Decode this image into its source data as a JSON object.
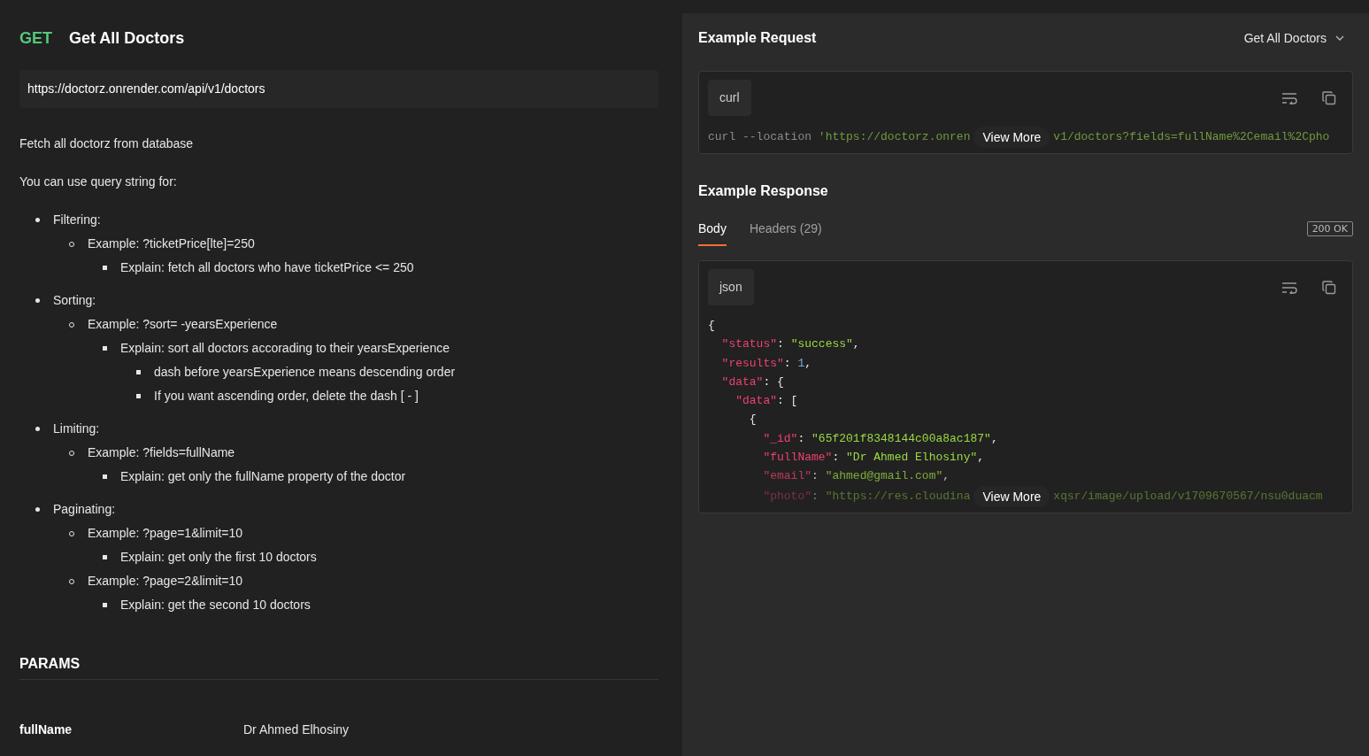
{
  "request": {
    "method": "GET",
    "title": "Get All Doctors",
    "url": "https://doctorz.onrender.com/api/v1/doctors"
  },
  "description": [
    "Fetch all doctorz from database",
    "You can use query string for:"
  ],
  "query_help": [
    {
      "text": "Filtering:",
      "children": [
        {
          "text": "Example: ?ticketPrice[lte]=250",
          "children": [
            {
              "text": "Explain: fetch all doctors who have ticketPrice <= 250"
            }
          ]
        }
      ]
    },
    {
      "text": "Sorting:",
      "children": [
        {
          "text": "Example: ?sort= -yearsExperience",
          "children": [
            {
              "text": "Explain: sort all doctors accorading to their yearsExperience",
              "children": [
                {
                  "text": "dash before yearsExperience means descending order"
                },
                {
                  "text": "If you want ascending order, delete the dash [ - ]"
                }
              ]
            }
          ]
        }
      ]
    },
    {
      "text": "Limiting:",
      "children": [
        {
          "text": "Example: ?fields=fullName",
          "children": [
            {
              "text": "Explain: get only the fullName property of the doctor"
            }
          ]
        }
      ]
    },
    {
      "text": "Paginating:",
      "children": [
        {
          "text": "Example: ?page=1&limit=10",
          "children": [
            {
              "text": "Explain: get only the first 10 doctors"
            }
          ]
        },
        {
          "text": "Example: ?page=2&limit=10",
          "children": [
            {
              "text": "Explain: get the second 10 doctors"
            }
          ]
        }
      ]
    }
  ],
  "params": {
    "title": "PARAMS",
    "rows": [
      {
        "key": "fullName",
        "value": "Dr Ahmed Elhosiny"
      }
    ]
  },
  "example_request": {
    "title": "Example Request",
    "selector": "Get All Doctors",
    "language": "curl",
    "lines": [
      [
        {
          "kind": "plain",
          "text": "curl --location "
        },
        {
          "kind": "url",
          "text": "'https://doctorz.onren"
        },
        {
          "kind": "more",
          "text": "View More"
        },
        {
          "kind": "url",
          "text": "v1/doctors?fields=fullName%2Cemail%2Cpho"
        }
      ]
    ]
  },
  "example_response": {
    "title": "Example Response",
    "tabs": [
      {
        "label": "Body",
        "selected": true
      },
      {
        "label": "Headers (29)",
        "selected": false
      }
    ],
    "status": "200 OK",
    "language": "json",
    "lines": [
      [
        {
          "kind": "punct",
          "text": "{"
        }
      ],
      [
        {
          "kind": "key",
          "text": "  \"status\""
        },
        {
          "kind": "punct",
          "text": ": "
        },
        {
          "kind": "string",
          "text": "\"success\""
        },
        {
          "kind": "punct",
          "text": ","
        }
      ],
      [
        {
          "kind": "key",
          "text": "  \"results\""
        },
        {
          "kind": "punct",
          "text": ": "
        },
        {
          "kind": "number",
          "text": "1"
        },
        {
          "kind": "punct",
          "text": ","
        }
      ],
      [
        {
          "kind": "key",
          "text": "  \"data\""
        },
        {
          "kind": "punct",
          "text": ": {"
        }
      ],
      [
        {
          "kind": "key",
          "text": "    \"data\""
        },
        {
          "kind": "punct",
          "text": ": ["
        }
      ],
      [
        {
          "kind": "punct",
          "text": "      {"
        }
      ],
      [
        {
          "kind": "key",
          "text": "        \"_id\""
        },
        {
          "kind": "punct",
          "text": ": "
        },
        {
          "kind": "string",
          "text": "\"65f201f8348144c00a8ac187\""
        },
        {
          "kind": "punct",
          "text": ","
        }
      ],
      [
        {
          "kind": "key",
          "text": "        \"fullName\""
        },
        {
          "kind": "punct",
          "text": ": "
        },
        {
          "kind": "string",
          "text": "\"Dr Ahmed Elhosiny\""
        },
        {
          "kind": "punct",
          "text": ","
        }
      ],
      [
        {
          "kind": "key",
          "text": "        \"email\""
        },
        {
          "kind": "punct",
          "text": ": "
        },
        {
          "kind": "string",
          "text": "\"ahmed@gmail.com\""
        },
        {
          "kind": "punct",
          "text": ","
        }
      ],
      [
        {
          "kind": "key",
          "text": "        \"photo\""
        },
        {
          "kind": "punct",
          "text": ": "
        },
        {
          "kind": "string",
          "text": "\"https://res.cloudina"
        },
        {
          "kind": "more",
          "text": "View More"
        },
        {
          "kind": "string",
          "text": "xqsr/image/upload/v1709670567/nsu0duacm"
        }
      ]
    ]
  }
}
